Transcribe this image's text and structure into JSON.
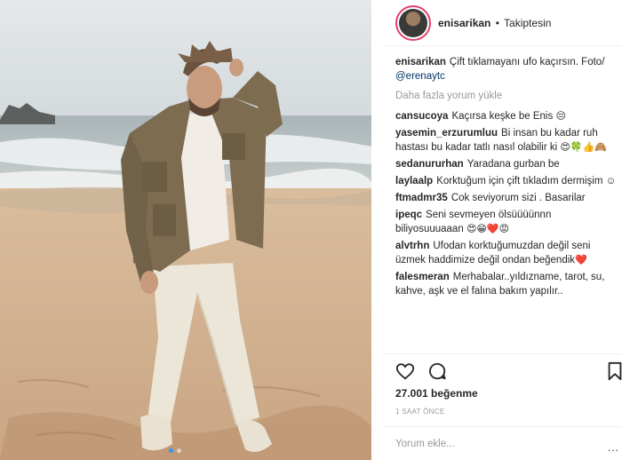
{
  "post": {
    "username": "enisarikan",
    "separator": "•",
    "follow_status": "Takiptesin",
    "caption_user": "enisarikan",
    "caption_text": "Çift tıklamayanı ufo kaçırsın. Foto/ ",
    "caption_mention": "@erenaytc",
    "load_more": "Daha fazla yorum yükle",
    "likes": "27.001 beğenme",
    "time": "1 SAAT ÖNCE",
    "add_comment_placeholder": "Yorum ekle...",
    "more_options": "..."
  },
  "comments": [
    {
      "user": "cansucoya",
      "text": "Kaçırsa keşke be Enis",
      "emoji": "😔"
    },
    {
      "user": "yasemin_erzurumluu",
      "text": "Bi insan bu kadar ruh hastası bu kadar tatlı nasıl olabilir ki",
      "emoji": "😍🍀👍🙈"
    },
    {
      "user": "sedanururhan",
      "text": "Yaradana gurban be",
      "emoji": ""
    },
    {
      "user": "laylaalp",
      "text": "Korktuğum için çift tıkladım dermişim ☺",
      "emoji": ""
    },
    {
      "user": "ftmadmr35",
      "text": "Cok seviyorum sizi . Basarilar",
      "emoji": ""
    },
    {
      "user": "ipeqc",
      "text": "Seni sevmeyen ölsüüüünnn biliyosuuuaaan",
      "emoji": "😍😁❤️😡"
    },
    {
      "user": "alvtrhn",
      "text": "Ufodan korktuğumuzdan değil seni üzmek haddimize değil ondan beğendik",
      "emoji": "❤️"
    },
    {
      "user": "falesmeran",
      "text": "Merhabalar..yıldızname, tarot, su, kahve, aşk ve el falına bakım yapılır..",
      "emoji": ""
    }
  ],
  "icons": {
    "like": "heart-icon",
    "comment": "speech-bubble-icon",
    "save": "bookmark-icon"
  },
  "colors": {
    "mention": "#003569",
    "story_ring": "#e0426c",
    "carousel_active": "#3897f0"
  }
}
